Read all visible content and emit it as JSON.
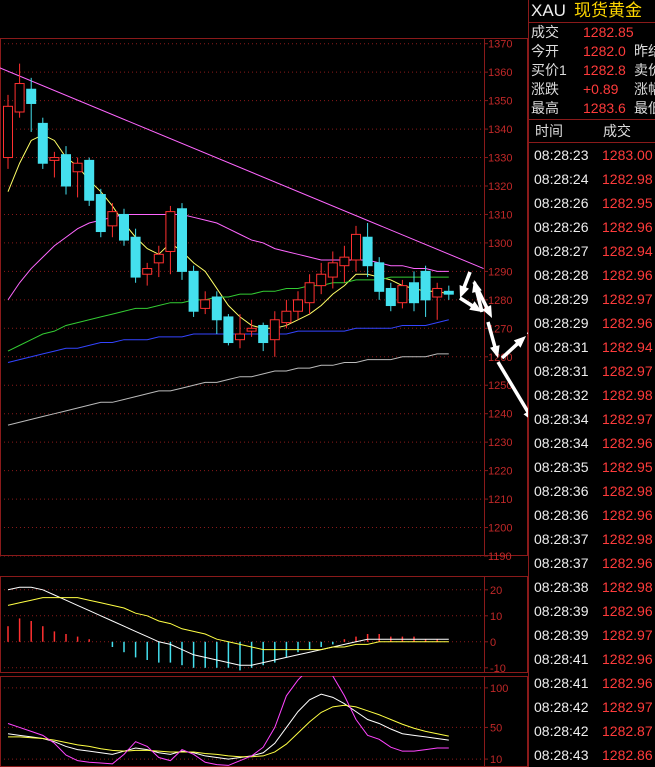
{
  "chart_data": [
    {
      "type": "candlestick",
      "ylim": [
        1190,
        1372
      ],
      "ticks": [
        1370,
        1360,
        1350,
        1340,
        1330,
        1320,
        1310,
        1300,
        1290,
        1280,
        1270,
        1260,
        1250,
        1240,
        1230,
        1220,
        1210,
        1200,
        1190
      ],
      "candles": [
        [
          1330,
          1348,
          1326,
          1352
        ],
        [
          1346,
          1356,
          1344,
          1363
        ],
        [
          1354,
          1349,
          1339,
          1358
        ],
        [
          1342,
          1328,
          1326,
          1344
        ],
        [
          1329,
          1330,
          1323,
          1332
        ],
        [
          1331,
          1320,
          1317,
          1334
        ],
        [
          1325,
          1328,
          1316,
          1330
        ],
        [
          1329,
          1315,
          1313,
          1330
        ],
        [
          1317,
          1304,
          1302,
          1319
        ],
        [
          1306,
          1311,
          1302,
          1314
        ],
        [
          1310,
          1301,
          1299,
          1312
        ],
        [
          1302,
          1288,
          1286,
          1305
        ],
        [
          1289,
          1291,
          1285,
          1293
        ],
        [
          1293,
          1296,
          1288,
          1299
        ],
        [
          1297,
          1311,
          1289,
          1313
        ],
        [
          1312,
          1290,
          1287,
          1314
        ],
        [
          1290,
          1276,
          1274,
          1292
        ],
        [
          1277,
          1280,
          1275,
          1283
        ],
        [
          1281,
          1273,
          1268,
          1283
        ],
        [
          1274,
          1265,
          1264,
          1275
        ],
        [
          1266,
          1268,
          1263,
          1275
        ],
        [
          1269,
          1270,
          1267,
          1273
        ],
        [
          1271,
          1265,
          1262,
          1272
        ],
        [
          1266,
          1273,
          1260,
          1276
        ],
        [
          1272,
          1276,
          1270,
          1280
        ],
        [
          1276,
          1280,
          1273,
          1283
        ],
        [
          1279,
          1286,
          1275,
          1289
        ],
        [
          1285,
          1289,
          1282,
          1293
        ],
        [
          1288,
          1293,
          1284,
          1297
        ],
        [
          1292,
          1295,
          1286,
          1299
        ],
        [
          1294,
          1303,
          1290,
          1306
        ],
        [
          1302,
          1292,
          1288,
          1307
        ],
        [
          1293,
          1283,
          1280,
          1295
        ],
        [
          1284,
          1278,
          1276,
          1286
        ],
        [
          1279,
          1285,
          1277,
          1287
        ],
        [
          1286,
          1279,
          1276,
          1290
        ],
        [
          1290,
          1280,
          1274,
          1292
        ],
        [
          1281,
          1284,
          1273,
          1286
        ],
        [
          1283,
          1282,
          1280,
          1285
        ]
      ],
      "ma_lines": [
        {
          "color": "#ffff66",
          "values": [
            1318,
            1328,
            1336,
            1338,
            1336,
            1330,
            1327,
            1322,
            1318,
            1313,
            1307,
            1302,
            1298,
            1296,
            1300,
            1297,
            1293,
            1290,
            1284,
            1278,
            1274,
            1271,
            1270,
            1270,
            1271,
            1273,
            1275,
            1278,
            1282,
            1285,
            1289,
            1289,
            1288,
            1287,
            1285,
            1284,
            1283,
            1283,
            1282
          ]
        },
        {
          "color": "#ff66ff",
          "values": [
            1280,
            1286,
            1291,
            1295,
            1299,
            1302,
            1305,
            1307,
            1308,
            1309,
            1310,
            1310,
            1310,
            1310,
            1310,
            1310,
            1309,
            1308,
            1307,
            1305,
            1303,
            1301,
            1300,
            1298,
            1297,
            1296,
            1295,
            1294,
            1294,
            1294,
            1294,
            1294,
            1293,
            1292,
            1292,
            1291,
            1291,
            1290,
            1290
          ]
        },
        {
          "color": "#33cc33",
          "values": [
            1262,
            1264,
            1266,
            1268,
            1269,
            1271,
            1272,
            1273,
            1274,
            1275,
            1276,
            1277,
            1277,
            1278,
            1279,
            1279,
            1280,
            1280,
            1281,
            1281,
            1282,
            1282,
            1283,
            1283,
            1284,
            1284,
            1285,
            1285,
            1286,
            1286,
            1287,
            1287,
            1287,
            1288,
            1288,
            1288,
            1288,
            1288,
            1288
          ]
        },
        {
          "color": "#3344ff",
          "values": [
            1258,
            1259,
            1260,
            1261,
            1262,
            1263,
            1263,
            1264,
            1265,
            1265,
            1266,
            1266,
            1266,
            1267,
            1267,
            1267,
            1268,
            1268,
            1268,
            1268,
            1268,
            1268,
            1268,
            1268,
            1268,
            1269,
            1269,
            1269,
            1269,
            1269,
            1270,
            1270,
            1270,
            1270,
            1271,
            1271,
            1271,
            1272,
            1273
          ]
        },
        {
          "color": "#bbbbbb",
          "values": [
            1236,
            1237,
            1238,
            1239,
            1240,
            1241,
            1242,
            1243,
            1244,
            1244,
            1245,
            1246,
            1247,
            1248,
            1248,
            1249,
            1250,
            1251,
            1251,
            1252,
            1253,
            1253,
            1254,
            1255,
            1255,
            1256,
            1256,
            1257,
            1257,
            1258,
            1258,
            1259,
            1259,
            1259,
            1260,
            1260,
            1260,
            1261,
            1261
          ]
        }
      ],
      "trendline": {
        "color": "#ff66ff",
        "from": [
          -1,
          1362
        ],
        "to": [
          41,
          1291
        ]
      }
    },
    {
      "type": "macd",
      "ylim": [
        -12,
        23
      ],
      "ticks": [
        20,
        10,
        0,
        -10
      ],
      "bars": [
        6,
        9,
        8,
        6,
        4,
        3,
        2,
        1,
        0,
        -2,
        -4,
        -6,
        -7,
        -8,
        -8,
        -9,
        -10,
        -10,
        -10,
        -10,
        -11,
        -10,
        -9,
        -8,
        -6,
        -4,
        -3,
        -2,
        -1,
        1,
        2,
        3,
        3,
        2,
        2,
        2,
        1,
        1,
        0
      ],
      "dif": [
        20,
        21,
        21,
        20,
        18,
        16,
        14,
        12,
        10,
        8,
        6,
        4,
        2,
        0,
        -1,
        -3,
        -5,
        -6,
        -7,
        -8,
        -9,
        -9,
        -8,
        -7,
        -6,
        -5,
        -4,
        -3,
        -2,
        -1,
        0,
        1,
        1,
        1,
        1,
        1,
        1,
        1,
        1
      ],
      "dea": [
        14,
        15,
        16,
        17,
        17,
        17,
        17,
        16,
        15,
        14,
        13,
        11,
        10,
        8,
        7,
        5,
        4,
        3,
        1,
        0,
        -1,
        -2,
        -3,
        -3,
        -3,
        -3,
        -3,
        -3,
        -2,
        -2,
        -1,
        -1,
        0,
        0,
        0,
        0,
        0,
        0,
        0
      ]
    },
    {
      "type": "kdj",
      "ylim": [
        0,
        115
      ],
      "ticks": [
        100,
        50,
        10
      ],
      "k": [
        42,
        40,
        38,
        36,
        32,
        26,
        22,
        20,
        18,
        16,
        20,
        24,
        22,
        18,
        16,
        20,
        18,
        14,
        12,
        10,
        12,
        14,
        18,
        30,
        50,
        70,
        85,
        92,
        88,
        80,
        70,
        60,
        55,
        48,
        42,
        40,
        38,
        36,
        34
      ],
      "d": [
        38,
        38,
        37,
        36,
        34,
        31,
        28,
        26,
        23,
        21,
        20,
        21,
        21,
        20,
        19,
        19,
        19,
        17,
        16,
        14,
        13,
        13,
        14,
        19,
        29,
        43,
        57,
        69,
        76,
        78,
        76,
        71,
        66,
        60,
        54,
        49,
        45,
        42,
        39
      ],
      "j": [
        55,
        50,
        45,
        40,
        30,
        15,
        8,
        6,
        5,
        4,
        16,
        32,
        26,
        12,
        8,
        22,
        16,
        6,
        3,
        2,
        8,
        14,
        25,
        50,
        90,
        110,
        125,
        135,
        115,
        90,
        60,
        40,
        35,
        25,
        20,
        20,
        22,
        24,
        24
      ]
    }
  ],
  "quote": {
    "symbol": "XAU",
    "name": "现货黄金",
    "rows": [
      {
        "k": "成交",
        "v": "1282.85",
        "k2": ""
      },
      {
        "k": "今开",
        "v": "1282.0",
        "k2": "昨结"
      },
      {
        "k": "买价1",
        "v": "1282.8",
        "k2": "卖价"
      },
      {
        "k": "涨跌",
        "v": "+0.89",
        "k2": "涨幅"
      },
      {
        "k": "最高",
        "v": "1283.6",
        "k2": "最低"
      }
    ]
  },
  "ticks_table": {
    "headers": [
      "时间",
      "成交"
    ],
    "rows": [
      [
        "08:28:23",
        "1283.00"
      ],
      [
        "08:28:24",
        "1282.98"
      ],
      [
        "08:28:26",
        "1282.95"
      ],
      [
        "08:28:26",
        "1282.96"
      ],
      [
        "08:28:27",
        "1282.94"
      ],
      [
        "08:28:28",
        "1282.96"
      ],
      [
        "08:28:29",
        "1282.97"
      ],
      [
        "08:28:29",
        "1282.96"
      ],
      [
        "08:28:31",
        "1282.94"
      ],
      [
        "08:28:31",
        "1282.97"
      ],
      [
        "08:28:32",
        "1282.98"
      ],
      [
        "08:28:34",
        "1282.97"
      ],
      [
        "08:28:34",
        "1282.96"
      ],
      [
        "08:28:35",
        "1282.95"
      ],
      [
        "08:28:36",
        "1282.98"
      ],
      [
        "08:28:36",
        "1282.96"
      ],
      [
        "08:28:37",
        "1282.98"
      ],
      [
        "08:28:37",
        "1282.96"
      ],
      [
        "08:28:38",
        "1282.98"
      ],
      [
        "08:28:39",
        "1282.96"
      ],
      [
        "08:28:39",
        "1282.97"
      ],
      [
        "08:28:41",
        "1282.96"
      ],
      [
        "08:28:41",
        "1282.96"
      ],
      [
        "08:28:42",
        "1282.97"
      ],
      [
        "08:28:42",
        "1282.87"
      ],
      [
        "08:28:43",
        "1282.86"
      ]
    ]
  },
  "colors": {
    "up": "#ff3030",
    "down": "#44e0ee",
    "grid": "#8a1a1a",
    "axis_text": "#c02828",
    "arrows": "#ffffff"
  }
}
